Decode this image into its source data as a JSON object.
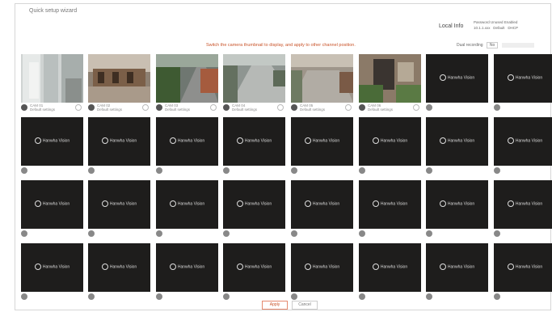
{
  "window": {
    "title": "Quick setup wizard"
  },
  "device_info": {
    "label": "Local Info",
    "rows": [
      [
        "Password",
        "Unused",
        "Enabled"
      ],
      [
        "10.1.1.xxx",
        "Default",
        "DHCP"
      ]
    ]
  },
  "hint": "Switch the camera thumbnail to display, and apply to other channel position.",
  "dual_recording": {
    "label": "Dual recording",
    "value": "No"
  },
  "brand_text": "Hanwha Vision",
  "cameras": [
    {
      "name": "CAM 01",
      "sub": "Default settings",
      "scene": "1"
    },
    {
      "name": "CAM 02",
      "sub": "Default settings",
      "scene": "2"
    },
    {
      "name": "CAM 03",
      "sub": "Default settings",
      "scene": "3"
    },
    {
      "name": "CAM 04",
      "sub": "Default settings",
      "scene": "4"
    },
    {
      "name": "CAM 05",
      "sub": "Default settings",
      "scene": "5"
    },
    {
      "name": "CAM 06",
      "sub": "Default settings",
      "scene": "6"
    }
  ],
  "buttons": {
    "ok": "Apply",
    "cancel": "Cancel"
  }
}
